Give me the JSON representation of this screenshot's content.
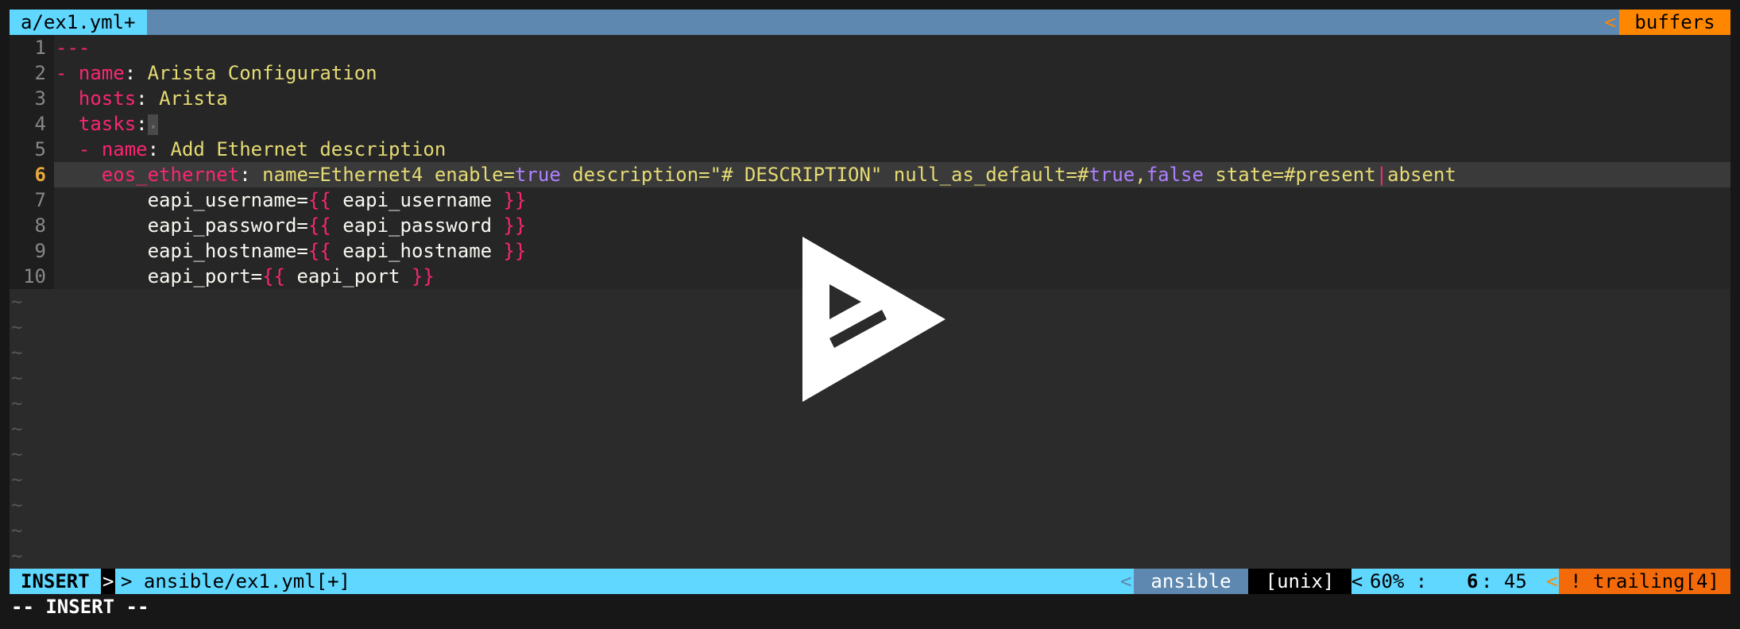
{
  "tabline": {
    "active_tab": "a/ex1.yml+",
    "sep": "<",
    "buffers_label": "buffers"
  },
  "lines": [
    {
      "n": "1"
    },
    {
      "n": "2"
    },
    {
      "n": "3"
    },
    {
      "n": "4"
    },
    {
      "n": "5"
    },
    {
      "n": "6"
    },
    {
      "n": "7"
    },
    {
      "n": "8"
    },
    {
      "n": "9"
    },
    {
      "n": "10"
    }
  ],
  "code": {
    "l1": "---",
    "l2_dash": "- ",
    "l2_key": "name",
    "l2_colon": ": ",
    "l2_val": "Arista Configuration",
    "l3_key": "hosts",
    "l3_colon": ": ",
    "l3_val": "Arista",
    "l4_key": "tasks",
    "l4_colon": ":",
    "l4_cursor": "·",
    "l5_dash": "- ",
    "l5_key": "name",
    "l5_colon": ": ",
    "l5_val": "Add Ethernet description",
    "l6_key": "eos_ethernet",
    "l6_colon": ": ",
    "l6_a": "name=Ethernet4 enable=",
    "l6_true": "true",
    "l6_b": " description=\"# DESCRIPTION\" null_as_default=#",
    "l6_true2": "true",
    "l6_comma": ",",
    "l6_false": "false",
    "l6_c": " state=#present",
    "l6_bar": "|",
    "l6_d": "absent",
    "l7_a": "eapi_username=",
    "l7_o": "{{",
    "l7_v": " eapi_username ",
    "l7_c": "}}",
    "l8_a": "eapi_password=",
    "l8_o": "{{",
    "l8_v": " eapi_password ",
    "l8_c": "}}",
    "l9_a": "eapi_hostname=",
    "l9_o": "{{",
    "l9_v": " eapi_hostname ",
    "l9_c": "}}",
    "l10_a": "eapi_port=",
    "l10_o": "{{",
    "l10_v": " eapi_port ",
    "l10_c": "}}"
  },
  "tilde": "~",
  "statusline": {
    "mode": "INSERT",
    "arrow": ">",
    "file": "> ansible/ex1.yml[+]",
    "lt": "<",
    "filetype": "ansible",
    "fileformat": "[unix]",
    "percent": "60% :",
    "line": "6",
    "col": ": 45",
    "warning": "! trailing[4]"
  },
  "cmdline": "-- INSERT --",
  "colors": {
    "keyword": "#f92672",
    "string": "#e6db74",
    "boolean": "#ae81ff",
    "accent": "#5fd7ff",
    "orange": "#ff8700"
  },
  "overlay_icon": "play-icon"
}
